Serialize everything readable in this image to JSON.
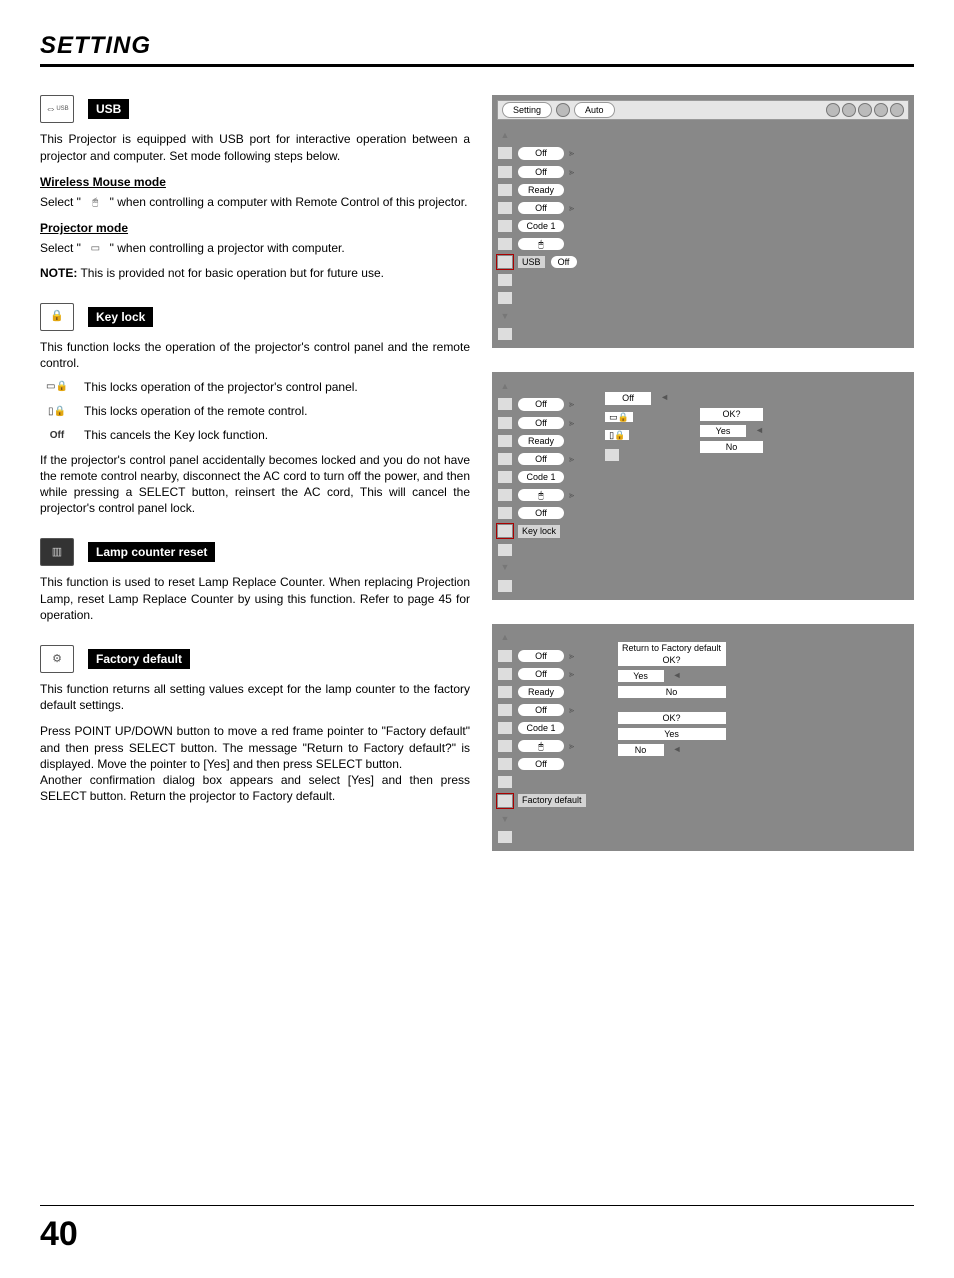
{
  "page": {
    "title": "SETTING",
    "number": "40"
  },
  "usb": {
    "tag": "USB",
    "intro": "This Projector is equipped with USB port for interactive operation between a projector and computer. Set mode following steps below.",
    "wireless_head": "Wireless Mouse mode",
    "wireless_a": "Select \"",
    "wireless_b": "\" when controlling a computer with Remote Control of this projector.",
    "projector_head": "Projector mode",
    "projector_a": "Select \"",
    "projector_b": "\" when controlling a projector with computer.",
    "note_label": "NOTE:",
    "note_text": " This is provided not for basic operation but for future use."
  },
  "keylock": {
    "tag": "Key lock",
    "intro": "This function locks the operation of the projector's control panel and the remote control.",
    "row1": "This locks operation of the projector's control panel.",
    "row2": "This locks operation of the remote control.",
    "row3_icon": "Off",
    "row3": "This cancels the Key lock function.",
    "para": "If the projector's control panel accidentally becomes locked and you do not have the remote control nearby, disconnect the AC cord to turn off the power, and then while pressing a SELECT button, reinsert the AC cord, This will cancel the projector's control panel lock."
  },
  "lamp": {
    "tag": "Lamp counter reset",
    "para": "This function is used to reset Lamp Replace Counter.  When replacing Projection Lamp, reset Lamp Replace Counter by using this function.  Refer to page 45 for operation."
  },
  "factory": {
    "tag": "Factory default",
    "p1": "This function returns all setting values except for the lamp counter to the factory default settings.",
    "p2": "Press POINT UP/DOWN button to move a red frame pointer to \"Factory default\" and then press SELECT button.  The message \"Return to Factory default?\" is displayed.  Move the pointer to [Yes] and then press SELECT button.",
    "p3": "Another confirmation dialog box appears and select [Yes] and then press SELECT button. Return the projector to Factory default."
  },
  "shot_top": {
    "setting": "Setting",
    "auto": "Auto"
  },
  "shot1": {
    "vals": [
      "Off",
      "Off",
      "Ready",
      "Off",
      "Code 1"
    ],
    "usb_label": "USB",
    "usb_val": "Off"
  },
  "shot2": {
    "vals": [
      "Off",
      "Off",
      "Ready",
      "Off",
      "Code 1",
      "",
      "Off"
    ],
    "pop_off": "Off",
    "label": "Key lock",
    "ok": "OK?",
    "yes": "Yes",
    "no": "No"
  },
  "shot3": {
    "vals": [
      "Off",
      "Off",
      "Ready",
      "Off",
      "Code 1",
      "",
      "Off"
    ],
    "return": "Return to Factory default\nOK?",
    "yes": "Yes",
    "no": "No",
    "ok": "OK?",
    "label": "Factory default"
  }
}
